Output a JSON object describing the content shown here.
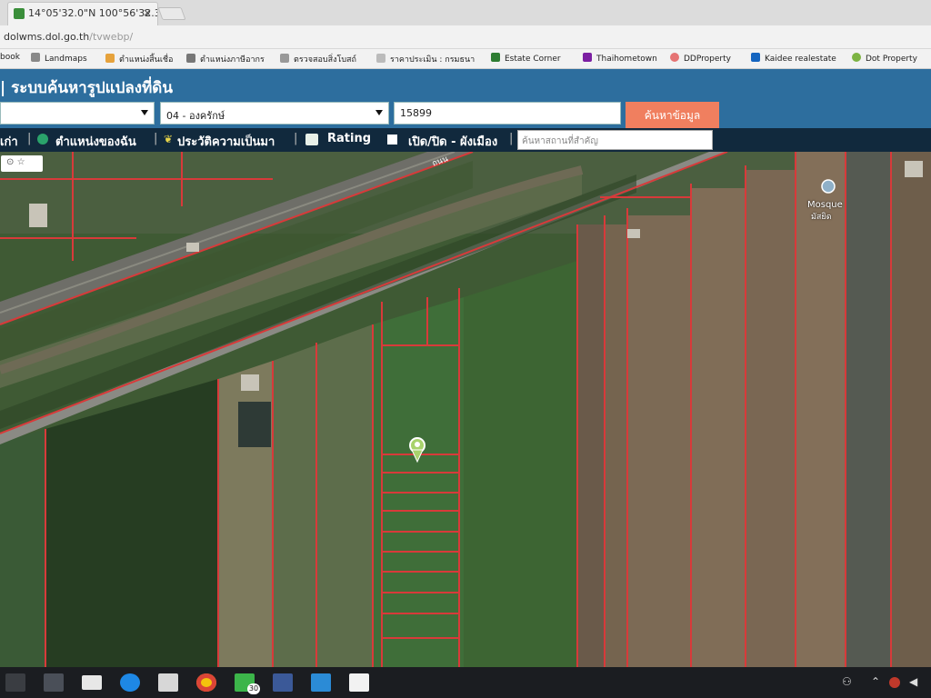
{
  "browser": {
    "tab_title": "14°05'32.0\"N 100°56'32.3",
    "tab_close": "×",
    "url_host": "dolwms.dol.go.th",
    "url_path": "/tvwebp/",
    "bookmarks": [
      {
        "label": "book",
        "icon_color": "#3b5998"
      },
      {
        "label": "Landmaps",
        "icon_color": "#888888"
      },
      {
        "label": "ตำแหน่งสิ้นเชื่อ",
        "icon_color": "#e6a23c"
      },
      {
        "label": "ตำแหน่งภาษีอากร",
        "icon_color": "#777777"
      },
      {
        "label": "ตรวจสอบสิ่งโบสถ์",
        "icon_color": "#999999"
      },
      {
        "label": "ราคาประเมิน : กรมธนา",
        "icon_color": "#bbbbbb"
      },
      {
        "label": "Estate Corner",
        "icon_color": "#2e7d32"
      },
      {
        "label": "Thaihometown",
        "icon_color": "#7b1fa2"
      },
      {
        "label": "DDProperty",
        "icon_color": "#e57373"
      },
      {
        "label": "Kaidee realestate",
        "icon_color": "#1565c0"
      },
      {
        "label": "Dot Property",
        "icon_color": "#7cb342"
      }
    ]
  },
  "app": {
    "title": "| ระบบค้นหารูปแปลงที่ดิน",
    "accent": "#2d6e9e",
    "toolbar_bg": "#11293d",
    "search_button_color": "#f07f5f",
    "form": {
      "province_value": "",
      "district_value": "04 - องครักษ์",
      "parcel_value": "15899",
      "search_button": "ค้นหาข้อมูล"
    },
    "toolbar": {
      "home": "เก่า",
      "my_location": "ตำแหน่งของฉัน",
      "history": "ประวัติความเป็นมา",
      "rating": "Rating",
      "toggle_layer": "เปิด/ปิด - ผังเมือง",
      "search_placeholder": "ค้นหาสถานที่สำคัญ",
      "sep": "|"
    }
  },
  "map": {
    "poi_label": "Mosque",
    "poi_sublabel": "มัสยิด",
    "road_label": "ถนน",
    "marker": "pin-icon",
    "control_labels": [
      "⊙",
      "☆"
    ]
  },
  "taskbar": {
    "apps": [
      "task-view-icon",
      "store-icon",
      "mail-icon",
      "edge-icon",
      "calculator-icon",
      "chrome-icon",
      "line-icon",
      "facebook-icon",
      "camera-icon",
      "sticky-notes-icon"
    ],
    "line_badge": "30",
    "tray": {
      "person": "⚇",
      "chevron": "⌃",
      "speaker": "◀"
    }
  }
}
